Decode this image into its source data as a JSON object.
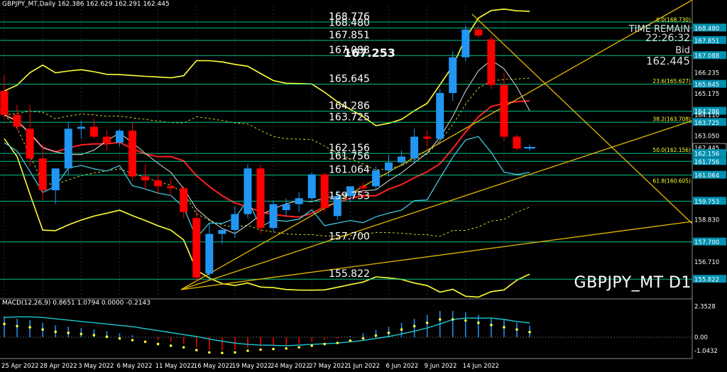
{
  "header": {
    "symbol_line": "GBPJPY_MT,Daily  162.386 162.629 162.291 162.445"
  },
  "info": {
    "time_remain_label": "TIME REMAIN",
    "time_remain_value": "22:26:32",
    "bid_label": "Bid",
    "bid_value": "162.445",
    "watermark": "GBPJPY_MT D1",
    "highlight_price": "167.253"
  },
  "colors": {
    "bull": "#2196f3",
    "bear": "#ff0000",
    "level_line": "#00e5a0",
    "ma_yellow": "#ffff33",
    "ma_red": "#ff2020",
    "ma_white": "#e0e0e0",
    "ma_cyan": "#40c8e0",
    "trend": "#e6b800",
    "axis_label_bg": "#0090b0"
  },
  "chart_data": {
    "type": "candlestick",
    "symbol": "GBPJPY_MT",
    "timeframe": "D1",
    "ylim": [
      154.9,
      169.6
    ],
    "candles": [
      {
        "o": 165.3,
        "h": 166.1,
        "l": 163.9,
        "c": 164.1
      },
      {
        "o": 164.1,
        "h": 164.6,
        "l": 163.3,
        "c": 163.5
      },
      {
        "o": 163.4,
        "h": 164.6,
        "l": 161.5,
        "c": 161.9
      },
      {
        "o": 161.9,
        "h": 162.6,
        "l": 159.8,
        "c": 160.3
      },
      {
        "o": 160.3,
        "h": 161.4,
        "l": 159.6,
        "c": 161.4
      },
      {
        "o": 161.4,
        "h": 163.7,
        "l": 161.1,
        "c": 163.4
      },
      {
        "o": 163.4,
        "h": 163.8,
        "l": 162.9,
        "c": 163.5
      },
      {
        "o": 163.5,
        "h": 163.9,
        "l": 162.9,
        "c": 163.0
      },
      {
        "o": 163.0,
        "h": 163.3,
        "l": 162.3,
        "c": 162.7
      },
      {
        "o": 162.7,
        "h": 163.4,
        "l": 162.5,
        "c": 163.3
      },
      {
        "o": 163.3,
        "h": 163.7,
        "l": 160.8,
        "c": 161.0
      },
      {
        "o": 161.0,
        "h": 161.6,
        "l": 160.3,
        "c": 160.8
      },
      {
        "o": 160.8,
        "h": 161.1,
        "l": 160.1,
        "c": 160.5
      },
      {
        "o": 160.5,
        "h": 160.9,
        "l": 160.0,
        "c": 160.4
      },
      {
        "o": 160.4,
        "h": 160.5,
        "l": 158.9,
        "c": 159.2
      },
      {
        "o": 158.9,
        "h": 159.3,
        "l": 155.7,
        "c": 155.9
      },
      {
        "o": 156.1,
        "h": 158.6,
        "l": 155.8,
        "c": 158.1
      },
      {
        "o": 158.1,
        "h": 158.4,
        "l": 157.6,
        "c": 158.3
      },
      {
        "o": 158.3,
        "h": 159.5,
        "l": 157.9,
        "c": 159.1
      },
      {
        "o": 159.1,
        "h": 161.6,
        "l": 158.9,
        "c": 161.4
      },
      {
        "o": 161.4,
        "h": 161.6,
        "l": 158.1,
        "c": 158.4
      },
      {
        "o": 158.4,
        "h": 159.8,
        "l": 158.2,
        "c": 159.6
      },
      {
        "o": 159.3,
        "h": 159.9,
        "l": 159.0,
        "c": 159.6
      },
      {
        "o": 159.6,
        "h": 160.2,
        "l": 159.2,
        "c": 159.9
      },
      {
        "o": 159.9,
        "h": 161.2,
        "l": 159.7,
        "c": 161.1
      },
      {
        "o": 161.1,
        "h": 161.2,
        "l": 159.2,
        "c": 159.4
      },
      {
        "o": 159.0,
        "h": 160.3,
        "l": 158.8,
        "c": 160.0
      },
      {
        "o": 160.0,
        "h": 160.5,
        "l": 159.7,
        "c": 160.5
      },
      {
        "o": 160.5,
        "h": 160.7,
        "l": 159.9,
        "c": 160.4
      },
      {
        "o": 160.5,
        "h": 161.5,
        "l": 160.3,
        "c": 161.3
      },
      {
        "o": 161.3,
        "h": 162.1,
        "l": 161.0,
        "c": 161.7
      },
      {
        "o": 161.7,
        "h": 162.3,
        "l": 161.5,
        "c": 162.0
      },
      {
        "o": 161.9,
        "h": 163.4,
        "l": 161.7,
        "c": 163.0
      },
      {
        "o": 163.0,
        "h": 163.3,
        "l": 162.5,
        "c": 162.9
      },
      {
        "o": 162.9,
        "h": 165.4,
        "l": 162.6,
        "c": 165.2
      },
      {
        "o": 165.2,
        "h": 167.3,
        "l": 164.8,
        "c": 167.0
      },
      {
        "o": 167.0,
        "h": 168.6,
        "l": 166.8,
        "c": 168.4
      },
      {
        "o": 168.4,
        "h": 168.6,
        "l": 168.0,
        "c": 168.1
      },
      {
        "o": 167.9,
        "h": 168.1,
        "l": 165.4,
        "c": 165.6
      },
      {
        "o": 165.6,
        "h": 166.2,
        "l": 162.8,
        "c": 163.0
      },
      {
        "o": 163.0,
        "h": 163.1,
        "l": 162.3,
        "c": 162.4
      },
      {
        "o": 162.4,
        "h": 162.6,
        "l": 162.3,
        "c": 162.445
      }
    ],
    "x_labels": [
      {
        "i": 0,
        "label": "25 Apr 2022"
      },
      {
        "i": 3,
        "label": "28 Apr 2022"
      },
      {
        "i": 6,
        "label": "3 May 2022"
      },
      {
        "i": 9,
        "label": "6 May 2022"
      },
      {
        "i": 12,
        "label": "11 May 2022"
      },
      {
        "i": 15,
        "label": "16 May 2022"
      },
      {
        "i": 18,
        "label": "19 May 2022"
      },
      {
        "i": 21,
        "label": "24 May 2022"
      },
      {
        "i": 24,
        "label": "27 May 2022"
      },
      {
        "i": 27,
        "label": "1 Jun 2022"
      },
      {
        "i": 30,
        "label": "6 Jun 2022"
      },
      {
        "i": 33,
        "label": "9 Jun 2022"
      },
      {
        "i": 36,
        "label": "14 Jun 2022"
      }
    ],
    "y_ticks": [
      "168.480",
      "167.851",
      "167.088",
      "166.235",
      "165.645",
      "165.175",
      "164.286",
      "164.110",
      "163.725",
      "163.050",
      "162.445",
      "162.156",
      "161.756",
      "161.064",
      "159.753",
      "158.830",
      "157.700",
      "156.710",
      "155.822"
    ],
    "levels": [
      {
        "price": 168.776,
        "label": "168.776"
      },
      {
        "price": 168.48,
        "label": "168.480"
      },
      {
        "price": 167.851,
        "label": "167.851"
      },
      {
        "price": 167.088,
        "label": "167.088"
      },
      {
        "price": 165.645,
        "label": "165.645"
      },
      {
        "price": 164.286,
        "label": "164.286"
      },
      {
        "price": 163.725,
        "label": "163.725"
      },
      {
        "price": 162.156,
        "label": "162.156"
      },
      {
        "price": 161.756,
        "label": "161.756"
      },
      {
        "price": 161.064,
        "label": "161.064"
      },
      {
        "price": 159.753,
        "label": "159.753"
      },
      {
        "price": 157.7,
        "label": "157.700"
      },
      {
        "price": 155.822,
        "label": "155.822"
      }
    ],
    "fib_levels": [
      {
        "price": 168.73,
        "label": "0.0(168.730)"
      },
      {
        "price": 165.627,
        "label": "23.6(165.627)"
      },
      {
        "price": 163.708,
        "label": "38.2(163.708)"
      },
      {
        "price": 162.156,
        "label": "50.0(162.156)"
      },
      {
        "price": 160.605,
        "label": "61.8(160.605)"
      }
    ],
    "macd": {
      "label": "MACD(12,26,9) 0.8651 1.0794 0.0000 -0.2143",
      "ylim": [
        -1.3,
        2.7
      ],
      "y_ticks": [
        "2.3528",
        "0.00",
        "-1.0432"
      ],
      "hist": [
        1.6,
        1.4,
        1.3,
        1.1,
        0.9,
        0.8,
        0.7,
        0.6,
        0.45,
        0.3,
        0.15,
        0.0,
        -0.2,
        -0.35,
        -0.5,
        -0.75,
        -0.95,
        -1.0,
        -0.95,
        -0.8,
        -0.7,
        -0.65,
        -0.6,
        -0.5,
        -0.35,
        -0.2,
        -0.1,
        0.1,
        0.3,
        0.55,
        0.8,
        1.1,
        1.4,
        1.7,
        2.0,
        2.0,
        1.9,
        1.7,
        1.5,
        1.3,
        1.1,
        0.87
      ],
      "signal": [
        1.5,
        1.55,
        1.55,
        1.5,
        1.4,
        1.3,
        1.2,
        1.1,
        1.0,
        0.9,
        0.8,
        0.65,
        0.5,
        0.35,
        0.2,
        0.05,
        -0.15,
        -0.3,
        -0.45,
        -0.55,
        -0.6,
        -0.62,
        -0.65,
        -0.6,
        -0.55,
        -0.5,
        -0.45,
        -0.35,
        -0.25,
        -0.1,
        0.05,
        0.25,
        0.45,
        0.7,
        1.0,
        1.35,
        1.45,
        1.45,
        1.45,
        1.35,
        1.2,
        1.08
      ]
    }
  }
}
